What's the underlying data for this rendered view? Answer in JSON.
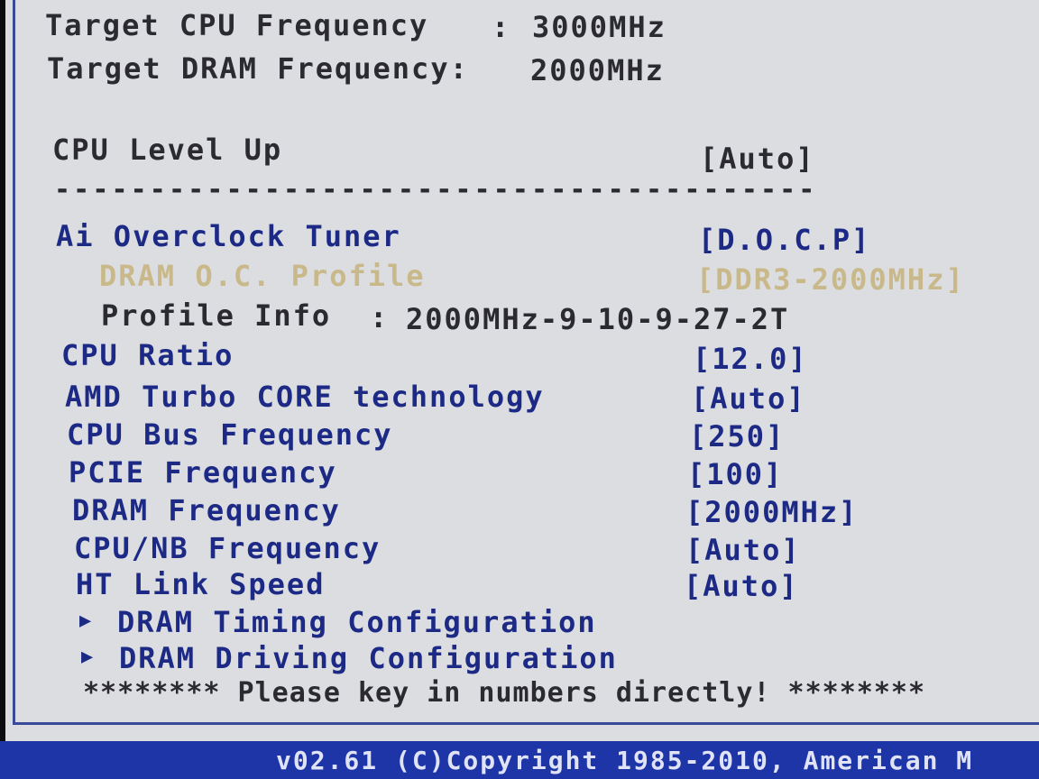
{
  "header": {
    "target_cpu_label": "Target CPU Frequency",
    "target_cpu_sep": ":",
    "target_cpu_value": "3000MHz",
    "target_dram_label": "Target DRAM Frequency:",
    "target_dram_value": "2000MHz"
  },
  "cpu_level_up": {
    "label": "CPU Level Up",
    "value": "[Auto]"
  },
  "divider": "----------------------------------------",
  "settings": {
    "ai_overclock_tuner": {
      "label": "Ai Overclock Tuner",
      "value": "[D.O.C.P]"
    },
    "dram_oc_profile": {
      "label": "DRAM O.C. Profile",
      "value": "[DDR3-2000MHz]"
    },
    "profile_info": {
      "label": "Profile Info",
      "sep": ":",
      "value": "2000MHz-9-10-9-27-2T"
    },
    "cpu_ratio": {
      "label": "CPU Ratio",
      "value": "[12.0]"
    },
    "amd_turbo_core": {
      "label": "AMD Turbo CORE technology",
      "value": "[Auto]"
    },
    "cpu_bus_frequency": {
      "label": "CPU Bus Frequency",
      "value": "[250]"
    },
    "pcie_frequency": {
      "label": "PCIE Frequency",
      "value": "[100]"
    },
    "dram_frequency": {
      "label": "DRAM Frequency",
      "value": "[2000MHz]"
    },
    "cpu_nb_frequency": {
      "label": "CPU/NB Frequency",
      "value": "[Auto]"
    },
    "ht_link_speed": {
      "label": "HT Link Speed",
      "value": "[Auto]"
    }
  },
  "submenus": {
    "arrow": "▶",
    "dram_timing": "DRAM Timing Configuration",
    "dram_driving": "DRAM Driving Configuration"
  },
  "hint": "******** Please key in numbers directly! ********",
  "footer": {
    "text": "v02.61 (C)Copyright 1985-2010, American M"
  },
  "colors": {
    "background": "#dcdde1",
    "text_dark": "#2a2a30",
    "text_blue": "#1c2a86",
    "highlight": "#c9b98a",
    "footer_bar": "#1e35a8"
  }
}
